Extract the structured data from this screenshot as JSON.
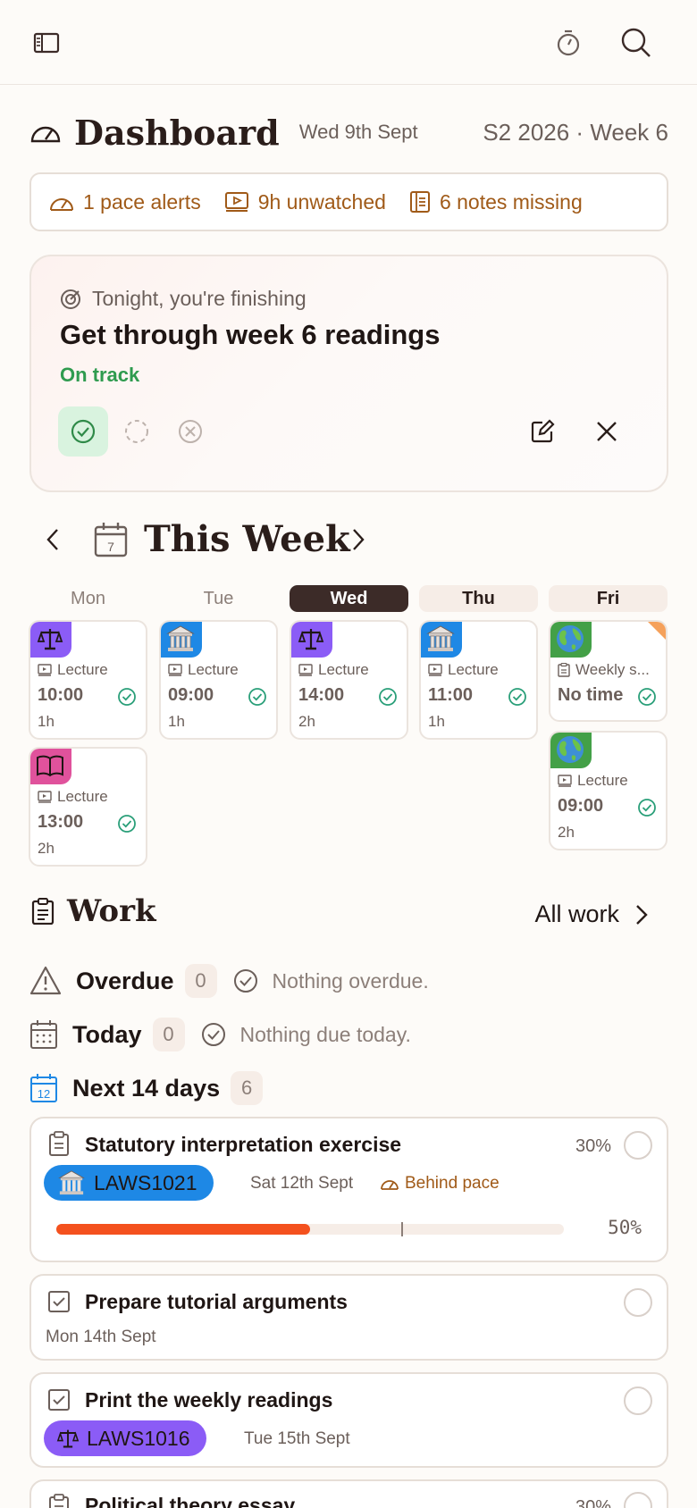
{
  "dashboard": {
    "title": "Dashboard",
    "date": "Wed 9th Sept",
    "term": "S2 2026 · Week 6"
  },
  "alerts": [
    {
      "icon": "gauge-icon",
      "label": "1 pace alerts"
    },
    {
      "icon": "video-icon",
      "label": "9h unwatched"
    },
    {
      "icon": "notes-icon",
      "label": "6 notes missing"
    }
  ],
  "tonight": {
    "label": "Tonight, you're finishing",
    "title": "Get through week 6 readings",
    "status": "On track",
    "status_color": "#2f9b4f"
  },
  "week": {
    "title": "This Week",
    "calendar_day": "7",
    "days": [
      {
        "label": "Mon",
        "state": "past"
      },
      {
        "label": "Tue",
        "state": "past"
      },
      {
        "label": "Wed",
        "state": "today"
      },
      {
        "label": "Thu",
        "state": "future"
      },
      {
        "label": "Fri",
        "state": "future"
      }
    ],
    "events": [
      {
        "kind": "Lecture",
        "time": "10:00",
        "duration": "1h",
        "badge": "scales-icon"
      },
      {
        "kind": "Lecture",
        "time": "13:00",
        "duration": "2h",
        "badge": "book-icon"
      },
      {
        "kind": "Lecture",
        "time": "09:00",
        "duration": "1h",
        "badge": "bank-icon"
      },
      {
        "kind": "Lecture",
        "time": "14:00",
        "duration": "2h",
        "badge": "scales-icon"
      },
      {
        "kind": "Lecture",
        "time": "11:00",
        "duration": "1h",
        "badge": "bank-icon"
      },
      {
        "kind": "Weekly s...",
        "time": "No time",
        "duration": "",
        "badge": "globe-icon"
      },
      {
        "kind": "Lecture",
        "time": "09:00",
        "duration": "2h",
        "badge": "globe-icon"
      }
    ]
  },
  "work": {
    "title": "Work",
    "all_label": "All work",
    "overdue": {
      "label": "Overdue",
      "count": "0",
      "empty": "Nothing overdue."
    },
    "today": {
      "label": "Today",
      "count": "0",
      "empty": "Nothing due today."
    },
    "next": {
      "label": "Next 14 days",
      "count": "6",
      "calendar_day": "12"
    },
    "tasks": [
      {
        "title": "Statutory interpretation exercise",
        "percent": "30%",
        "course": "LAWS1021",
        "due": "Sat 12th Sept",
        "pace": "Behind pace",
        "progress_label": "50%",
        "progress": 0.5,
        "pace_marker": 0.68
      },
      {
        "title": "Prepare tutorial arguments",
        "due": "Mon 14th Sept"
      },
      {
        "title": "Print the weekly readings",
        "course": "LAWS1016",
        "due": "Tue 15th Sept"
      },
      {
        "title": "Political theory essay",
        "percent": "30%"
      }
    ]
  },
  "colors": {
    "accent_alert": "#a05a18",
    "progress_fill": "#f4511e",
    "today_header": "#3c2b28",
    "course_blue": "#1e88e5",
    "course_purple": "#8b5cf6"
  }
}
